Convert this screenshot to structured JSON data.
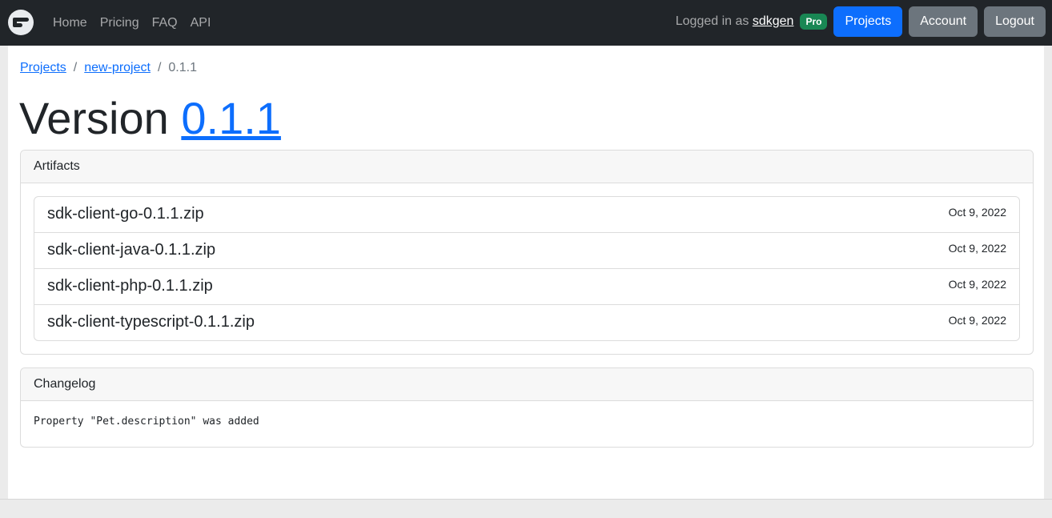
{
  "nav": {
    "brand_icon": "logo-icon",
    "links": [
      "Home",
      "Pricing",
      "FAQ",
      "API"
    ],
    "logged_in_prefix": "Logged in as",
    "username": "sdkgen",
    "badge": "Pro",
    "buttons": {
      "projects": "Projects",
      "account": "Account",
      "logout": "Logout"
    }
  },
  "breadcrumb": {
    "projects": "Projects",
    "project": "new-project",
    "version": "0.1.1",
    "separator": "/"
  },
  "title": {
    "prefix": "Version",
    "version": "0.1.1"
  },
  "artifacts": {
    "header": "Artifacts",
    "items": [
      {
        "name": "sdk-client-go-0.1.1.zip",
        "date": "Oct 9, 2022"
      },
      {
        "name": "sdk-client-java-0.1.1.zip",
        "date": "Oct 9, 2022"
      },
      {
        "name": "sdk-client-php-0.1.1.zip",
        "date": "Oct 9, 2022"
      },
      {
        "name": "sdk-client-typescript-0.1.1.zip",
        "date": "Oct 9, 2022"
      }
    ]
  },
  "changelog": {
    "header": "Changelog",
    "text": "Property \"Pet.description\" was added"
  },
  "colors": {
    "navbar": "#212529",
    "primary": "#0d6efd",
    "secondary": "#6c757d",
    "badge": "#198754"
  }
}
